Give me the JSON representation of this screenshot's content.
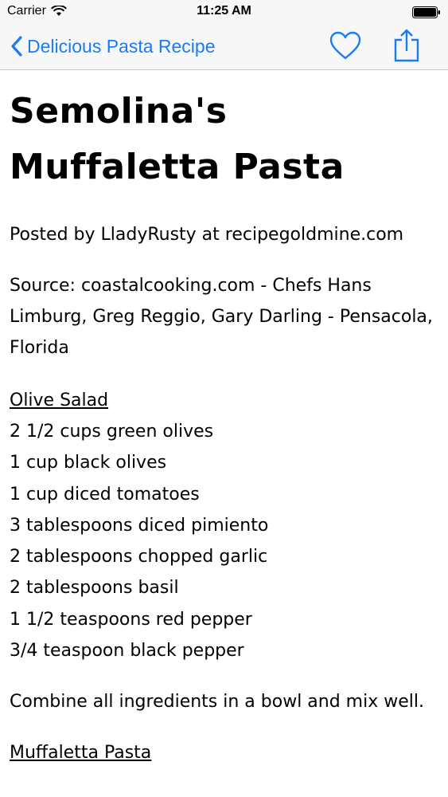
{
  "status": {
    "carrier": "Carrier",
    "time": "11:25 AM"
  },
  "nav": {
    "back_label": "Delicious Pasta Recipe",
    "accent": "#1a7cf5"
  },
  "recipe": {
    "title": "Semolina's Muffaletta Pasta",
    "posted_by": "Posted by LladyRusty at recipegoldmine.com",
    "source": "Source: coastalcooking.com - Chefs Hans Limburg, Greg Reggio, Gary Darling - Pensacola, Florida",
    "section1_title": "Olive Salad",
    "ingredients": [
      "2 1/2 cups green olives",
      "1 cup black olives",
      "1 cup diced tomatoes",
      "3 tablespoons diced pimiento",
      "2 tablespoons chopped garlic",
      "2 tablespoons basil",
      "1 1/2 teaspoons red pepper",
      "3/4 teaspoon black pepper"
    ],
    "instruction": "Combine all ingredients in a bowl and mix well.",
    "section2_title": "Muffaletta Pasta"
  }
}
